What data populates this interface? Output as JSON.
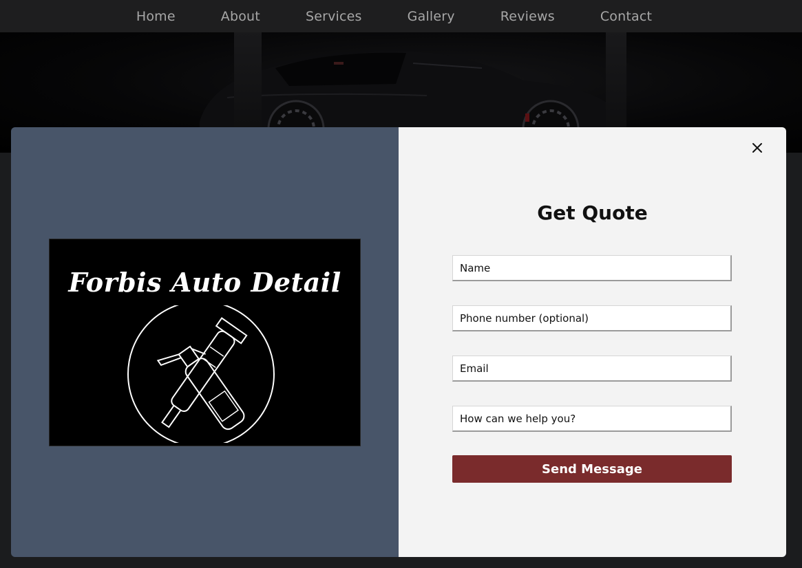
{
  "nav": {
    "items": [
      {
        "label": "Home"
      },
      {
        "label": "About"
      },
      {
        "label": "Services"
      },
      {
        "label": "Gallery"
      },
      {
        "label": "Reviews"
      },
      {
        "label": "Contact"
      }
    ]
  },
  "hero": {
    "image": "dark-sports-car-photo"
  },
  "modal": {
    "logo": {
      "text": "Forbis Auto Detail",
      "emblem": "spray-bottle-and-polisher-emblem"
    },
    "close_icon": "close-icon",
    "form": {
      "title": "Get Quote",
      "name_placeholder": "Name",
      "phone_placeholder": "Phone number (optional)",
      "email_placeholder": "Email",
      "message_placeholder": "How can we help you?",
      "submit_label": "Send Message"
    }
  },
  "colors": {
    "navbar_bg": "#1e1e1f",
    "nav_text": "#a7a7a7",
    "modal_left_bg": "#485569",
    "modal_right_bg": "#f3f3f3",
    "button_bg": "#7a2b2c"
  }
}
